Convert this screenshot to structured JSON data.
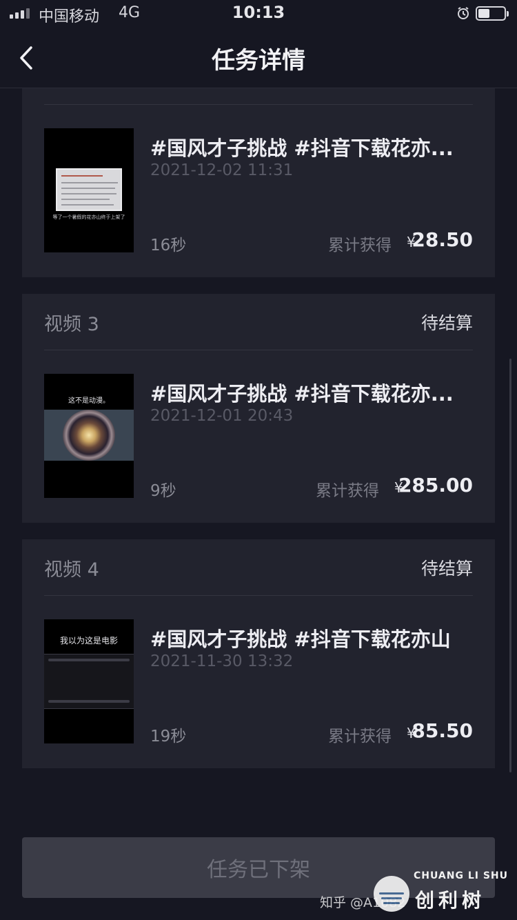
{
  "status_bar": {
    "carrier": "中国移动",
    "network": "4G",
    "time": "10:13",
    "battery_level": 0.45
  },
  "nav": {
    "title": "任务详情"
  },
  "cards": [
    {
      "title": "#国风才子挑战 #抖音下载花亦...",
      "date": "2021-12-02 11:31",
      "duration": "16秒",
      "earn_label": "累计获得",
      "currency": "¥",
      "amount": "28.50",
      "thumb_caption": "等了一个暑假的花亦山终于上架了"
    },
    {
      "label": "视频 3",
      "status": "待结算",
      "title": "#国风才子挑战 #抖音下载花亦...",
      "date": "2021-12-01 20:43",
      "duration": "9秒",
      "earn_label": "累计获得",
      "currency": "¥",
      "amount": "285.00",
      "thumb_caption": "这不是动漫。"
    },
    {
      "label": "视频 4",
      "status": "待结算",
      "title": "#国风才子挑战 #抖音下载花亦山",
      "date": "2021-11-30 13:32",
      "duration": "19秒",
      "earn_label": "累计获得",
      "currency": "¥",
      "amount": "85.50",
      "thumb_caption": "我以为这是电影"
    }
  ],
  "footer": {
    "button_label": "任务已下架"
  },
  "watermark": {
    "brand_en": "CHUANG LI SHU",
    "brand_cn": "创利树",
    "zhihu": "知乎 @A1082"
  }
}
